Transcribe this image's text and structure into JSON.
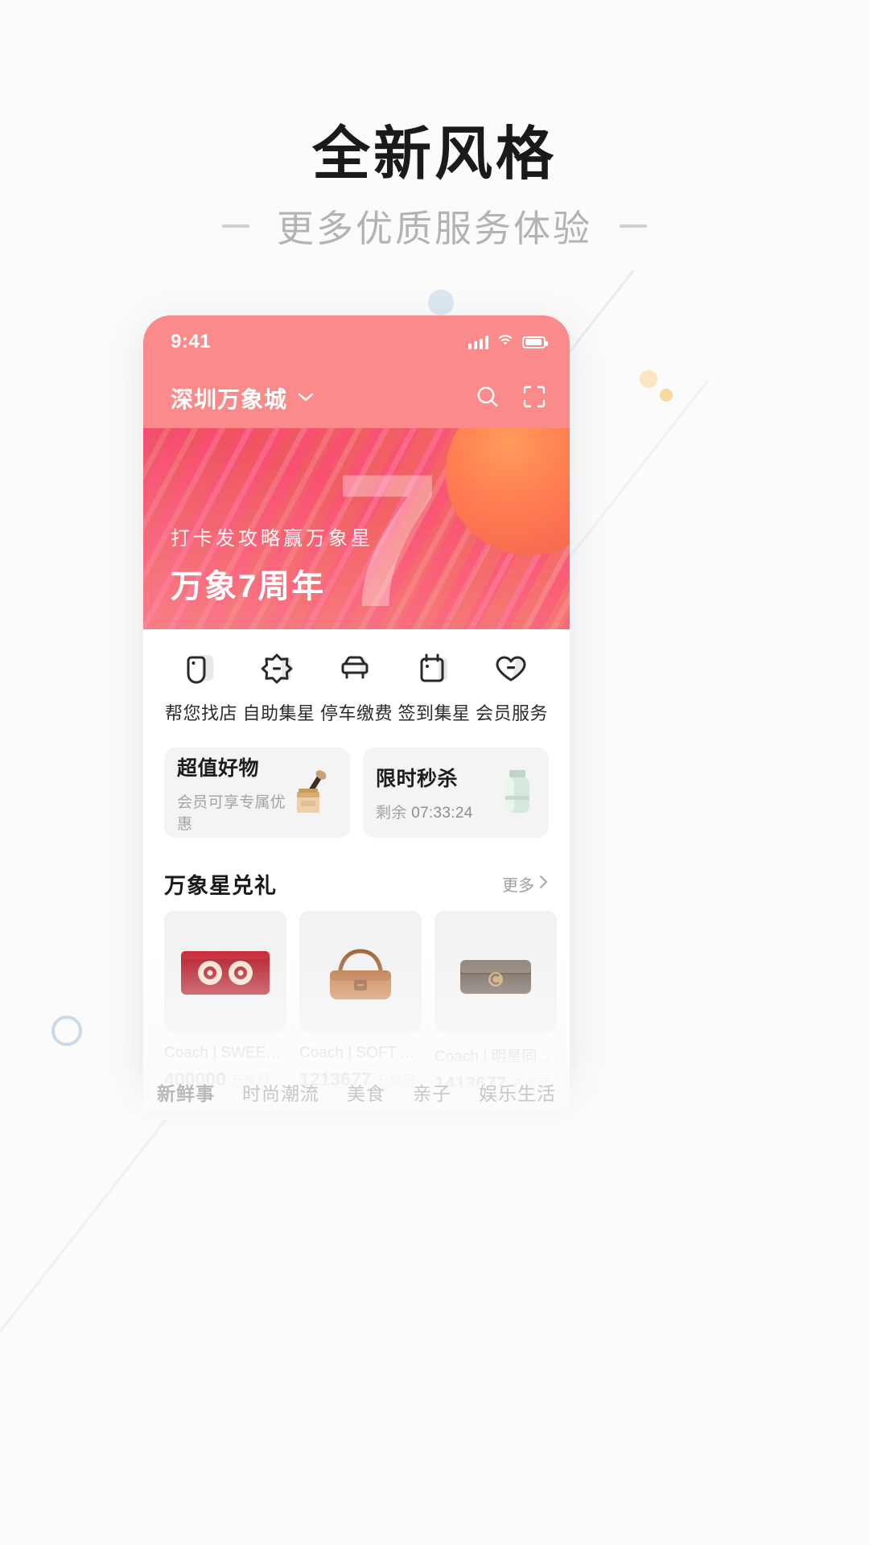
{
  "page": {
    "headline": "全新风格",
    "subtitle": "更多优质服务体验"
  },
  "phone": {
    "status": {
      "time": "9:41",
      "signal_icon": "cellular-signal-icon",
      "wifi_icon": "wifi-icon",
      "battery_icon": "battery-icon"
    },
    "header": {
      "location": "深圳万象城",
      "chevron_icon": "chevron-down-icon",
      "search_icon": "search-icon",
      "scan_icon": "scan-icon"
    },
    "banner": {
      "subtitle": "打卡发攻略赢万象星",
      "title": "万象7周年",
      "numeral": "7"
    },
    "quick_actions": [
      {
        "label": "帮您找店",
        "icon": "tag-icon"
      },
      {
        "label": "自助集星",
        "icon": "star-burst-icon"
      },
      {
        "label": "停车缴费",
        "icon": "car-icon"
      },
      {
        "label": "签到集星",
        "icon": "calendar-icon"
      },
      {
        "label": "会员服务",
        "icon": "heart-icon"
      }
    ],
    "promos": [
      {
        "title": "超值好物",
        "subtitle": "会员可享专属优惠",
        "thumb": "cosmetics-thumb"
      },
      {
        "title": "限时秒杀",
        "subtitle_label": "剩余",
        "countdown": "07:33:24",
        "thumb": "bottle-thumb"
      }
    ],
    "gift_section": {
      "title": "万象星兑礼",
      "more_label": "更多",
      "more_icon": "chevron-right-icon",
      "items": [
        {
          "name": "Coach | SWEETIE",
          "points": "400000",
          "unit": "万象星",
          "thumb": "red-card-case"
        },
        {
          "name": "Coach | SOFT ...",
          "points": "1213677",
          "unit": "万象星",
          "thumb": "tan-shoulder-bag"
        },
        {
          "name": "Coach | 明星同...",
          "points": "1413677",
          "unit": "万象星",
          "thumb": "brown-flap-bag"
        },
        {
          "name": "",
          "points": "",
          "unit": "",
          "thumb": "partial-card"
        }
      ]
    },
    "bottom_tabs": [
      {
        "label": "新鲜事",
        "active": true
      },
      {
        "label": "时尚潮流",
        "active": false
      },
      {
        "label": "美食",
        "active": false
      },
      {
        "label": "亲子",
        "active": false
      },
      {
        "label": "娱乐生活",
        "active": false
      }
    ]
  },
  "colors": {
    "header_red": "#fb8b8b",
    "banner_red": "#f15c63",
    "page_bg": "#fbfbfb",
    "text_dark": "#1a1a1a",
    "text_muted": "#b3b3b3"
  }
}
